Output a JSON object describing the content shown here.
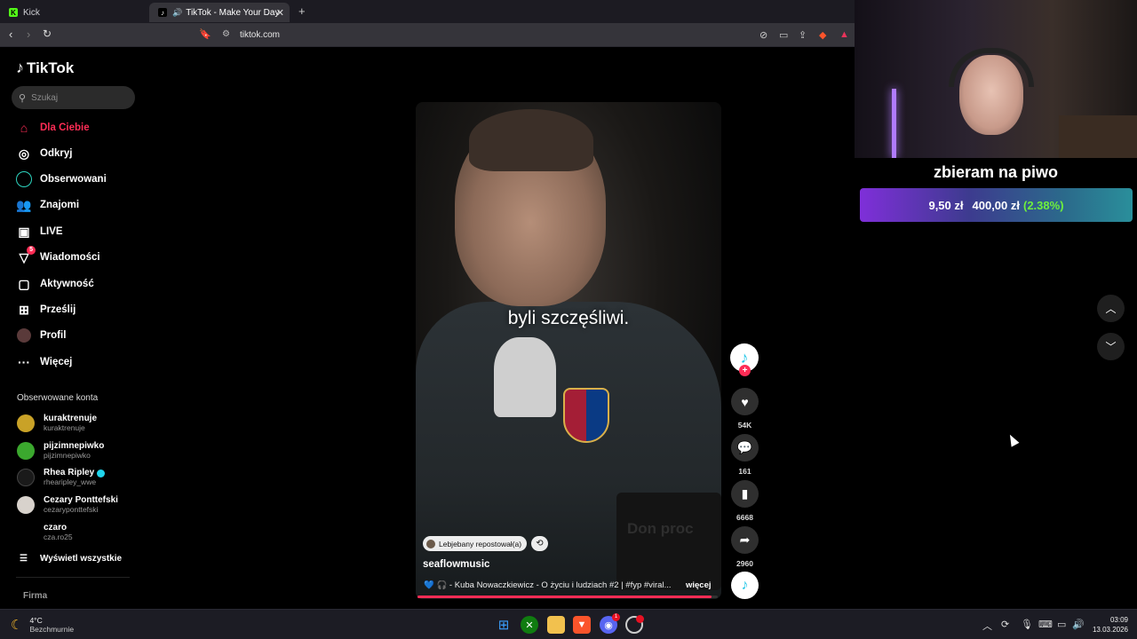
{
  "browser": {
    "tabs": [
      {
        "title": "Kick",
        "active": false
      },
      {
        "title": "TikTok - Make Your Day",
        "active": true
      }
    ],
    "new_tab": "+",
    "url": "tiktok.com"
  },
  "sidebar": {
    "logo": "TikTok",
    "search_placeholder": "Szukaj",
    "nav": [
      {
        "label": "Dla Ciebie",
        "icon": "home-icon",
        "active": true
      },
      {
        "label": "Odkryj",
        "icon": "compass-icon"
      },
      {
        "label": "Obserwowani",
        "icon": "following-icon"
      },
      {
        "label": "Znajomi",
        "icon": "friends-icon"
      },
      {
        "label": "LIVE",
        "icon": "live-icon"
      },
      {
        "label": "Wiadomości",
        "icon": "messages-icon",
        "badge": "5"
      },
      {
        "label": "Aktywność",
        "icon": "activity-icon"
      },
      {
        "label": "Prześlij",
        "icon": "upload-icon"
      },
      {
        "label": "Profil",
        "icon": "profile-icon"
      },
      {
        "label": "Więcej",
        "icon": "more-icon"
      }
    ],
    "following_title": "Obserwowane konta",
    "accounts": [
      {
        "name": "kuraktrenuje",
        "handle": "kuraktrenuje",
        "color": "#c9a227"
      },
      {
        "name": "pijzimnepiwko",
        "handle": "pijzimnepiwko",
        "color": "#3ba82e"
      },
      {
        "name": "Rhea Ripley",
        "handle": "rhearipley_wwe",
        "color": "#1a1a1a",
        "verified": true
      },
      {
        "name": "Cezary Ponttefski",
        "handle": "cezaryponttefski",
        "color": "#d8d2cc"
      },
      {
        "name": "czaro",
        "handle": "cza.ro25",
        "color": "#000000"
      }
    ],
    "show_all": "Wyświetl wszystkie",
    "footer": "Firma"
  },
  "video": {
    "caption": "byli szczęśliwi.",
    "mug_text": "Don proc",
    "repost_label": "Lebjebany repostował(a)",
    "author": "seaflowmusic",
    "description": "💙 🎧 - Kuba Nowaczkiewicz - O życiu i ludziach #2 | #fyp #viral...",
    "more": "więcej",
    "progress": 0.98
  },
  "actions": {
    "likes": "54K",
    "comments": "161",
    "saves": "6668",
    "shares": "2960"
  },
  "stream": {
    "donation_title": "zbieram na piwo",
    "current": "9,50 zł",
    "goal": "400,00 zł",
    "percent": "(2.38%)"
  },
  "taskbar": {
    "temperature": "4°C",
    "weather": "Bezchmurnie",
    "time": "03:09",
    "date": "13.03.2026",
    "discord_badge": "1"
  }
}
